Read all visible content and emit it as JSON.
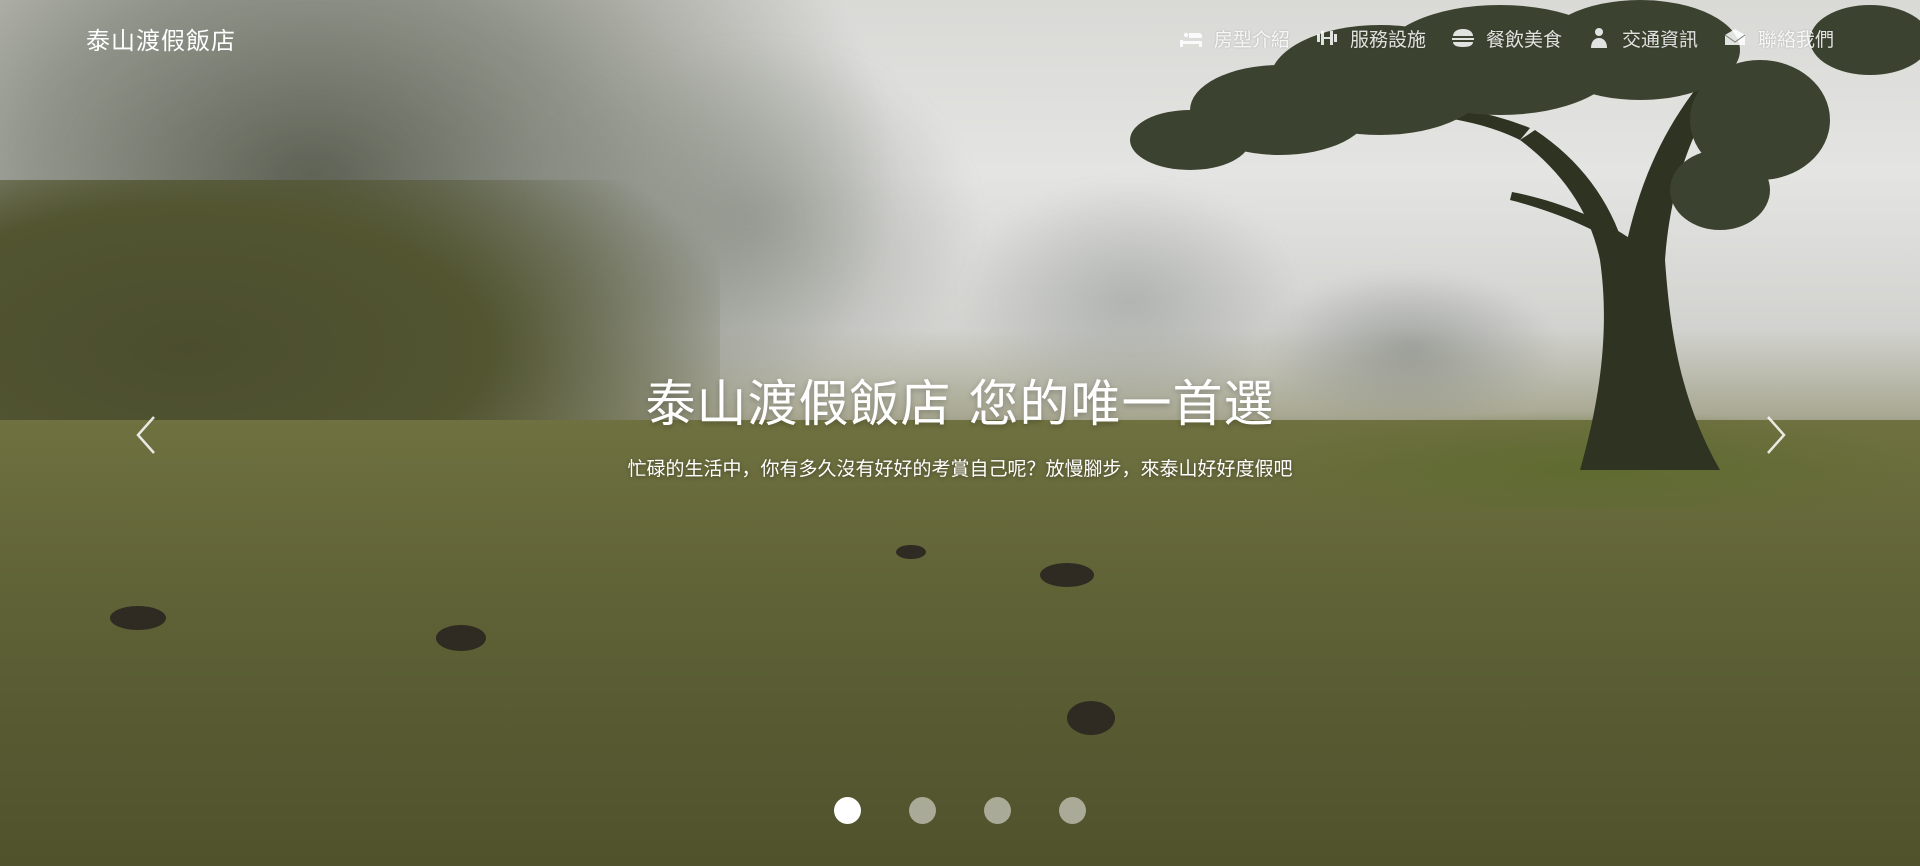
{
  "brand": "泰山渡假飯店",
  "nav": [
    {
      "icon": "bed-icon",
      "label": "房型介紹"
    },
    {
      "icon": "dumbbell-icon",
      "label": "服務設施"
    },
    {
      "icon": "burger-icon",
      "label": "餐飲美食"
    },
    {
      "icon": "person-icon",
      "label": "交通資訊"
    },
    {
      "icon": "chat-icon",
      "label": "聯絡我們"
    }
  ],
  "carousel": {
    "title": "泰山渡假飯店 您的唯一首選",
    "subtitle": "忙碌的生活中，你有多久沒有好好的考賞自己呢？放慢腳步，來泰山好好度假吧",
    "active_slide": 1,
    "slide_count": 4
  }
}
